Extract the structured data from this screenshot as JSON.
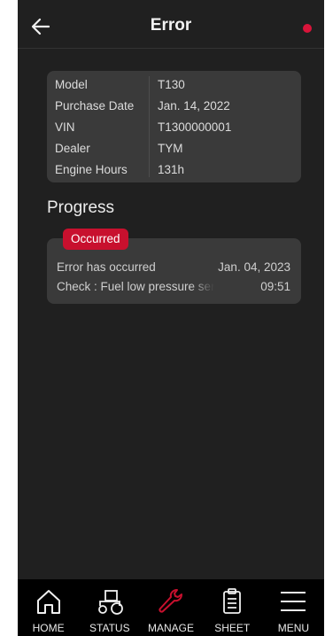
{
  "header": {
    "title": "Error"
  },
  "colors": {
    "accent": "#c8102e",
    "background": "#202020",
    "card": "#3a3a3a"
  },
  "info": {
    "rows": [
      {
        "key": "Model",
        "value": "T130"
      },
      {
        "key": "Purchase Date",
        "value": "Jan. 14, 2022"
      },
      {
        "key": "VIN",
        "value": "T1300000001"
      },
      {
        "key": "Dealer",
        "value": "TYM"
      },
      {
        "key": "Engine Hours",
        "value": "131h"
      }
    ]
  },
  "progress": {
    "title": "Progress",
    "event": {
      "badge": "Occurred",
      "line1": "Error has occurred",
      "line2": "Check : Fuel low pressure sensor",
      "date": "Jan. 04, 2023",
      "time": "09:51"
    }
  },
  "nav": {
    "items": [
      {
        "label": "HOME",
        "icon": "home-icon"
      },
      {
        "label": "STATUS",
        "icon": "tractor-icon"
      },
      {
        "label": "MANAGE",
        "icon": "wrench-icon"
      },
      {
        "label": "SHEET",
        "icon": "clipboard-icon"
      },
      {
        "label": "MENU",
        "icon": "hamburger-icon"
      }
    ]
  }
}
